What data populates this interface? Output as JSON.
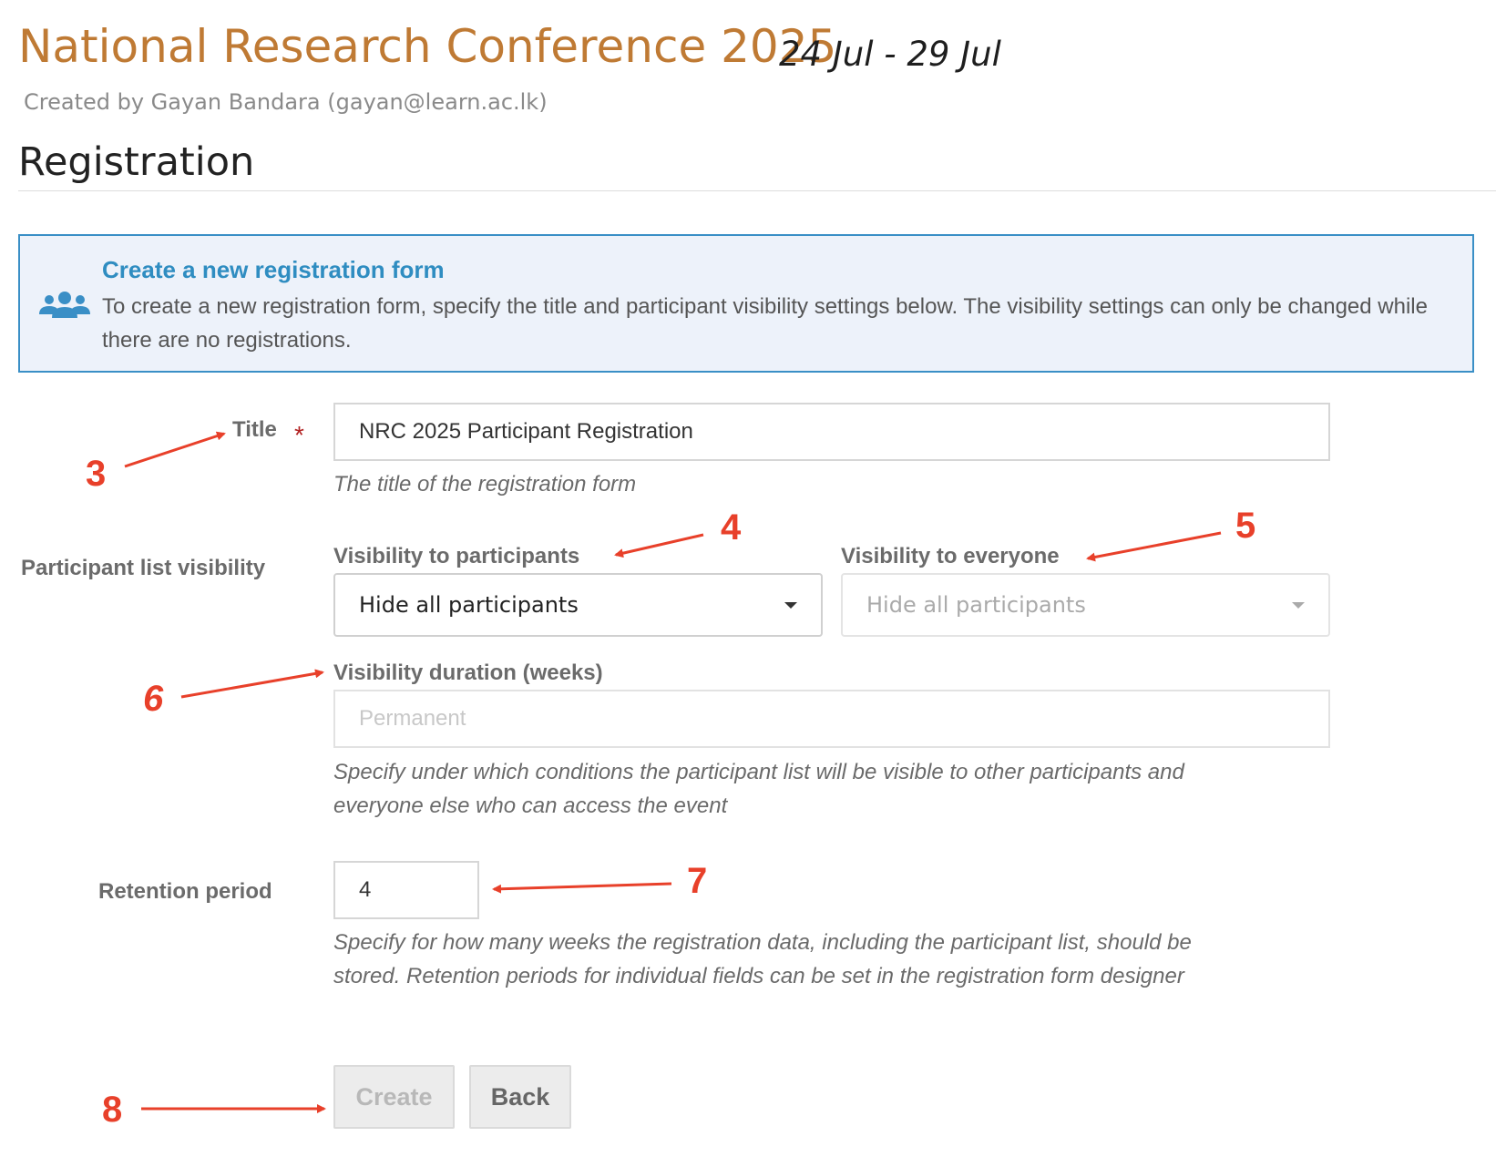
{
  "event": {
    "title": "National Research Conference 2025",
    "dates": "24 Jul - 29 Jul",
    "created_by": "Created by Gayan Bandara (gayan@learn.ac.lk)"
  },
  "page": {
    "heading": "Registration"
  },
  "info": {
    "icon": "users-icon",
    "title": "Create a new registration form",
    "text": "To create a new registration form, specify the title and participant visibility settings below. The visibility settings can only be changed while there are no registrations."
  },
  "form": {
    "title": {
      "label": "Title",
      "required_mark": "*",
      "value": "NRC 2025 Participant Registration",
      "help": "The title of the registration form"
    },
    "visibility": {
      "label": "Participant list visibility",
      "participants_label": "Visibility to participants",
      "participants_value": "Hide all participants",
      "everyone_label": "Visibility to everyone",
      "everyone_value": "Hide all participants",
      "duration_label": "Visibility duration (weeks)",
      "duration_placeholder": "Permanent",
      "help": "Specify under which conditions the participant list will be visible to other participants and everyone else who can access the event"
    },
    "retention": {
      "label": "Retention period",
      "value": "4",
      "help": "Specify for how many weeks the registration data, including the participant list, should be stored. Retention periods for individual fields can be set in the registration form designer"
    },
    "buttons": {
      "create": "Create",
      "back": "Back"
    }
  },
  "annotations": [
    "3",
    "4",
    "5",
    "6",
    "7",
    "8"
  ],
  "colors": {
    "accent": "#bf7a34",
    "info_title": "#2f8dc1",
    "info_border": "#3a8fc6",
    "info_bg": "#edf2fa",
    "annotation": "#e8402a"
  }
}
